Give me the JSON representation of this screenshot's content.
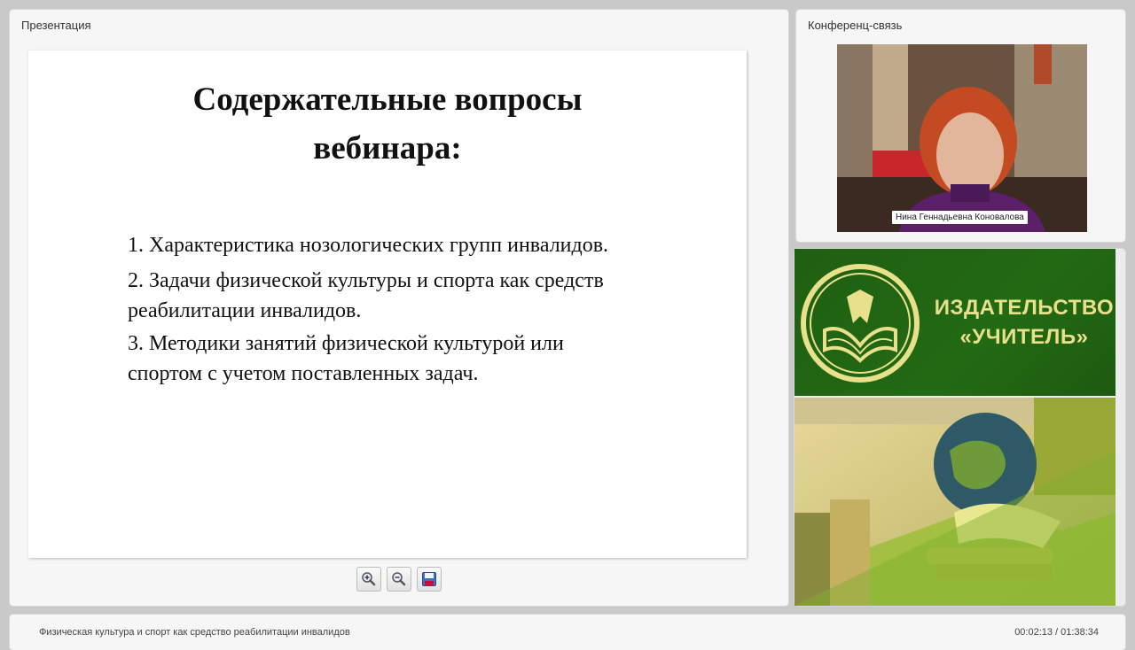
{
  "presentation": {
    "panel_title": "Презентация",
    "slide": {
      "title_line1": "Содержательные вопросы",
      "title_line2": "вебинара:",
      "items": [
        {
          "line1": "1. Характеристика нозологических групп инвалидов.",
          "line2": ""
        },
        {
          "line1": "2. Задачи физической культуры и спорта как средств",
          "line2": "реабилитации инвалидов."
        },
        {
          "line1": "3. Методики занятий физической культурой или",
          "line2": "спортом с учетом поставленных задач."
        }
      ]
    },
    "toolbar": {
      "zoom_in_icon": "zoom-in-icon",
      "zoom_out_icon": "zoom-out-icon",
      "save_icon": "floppy-disk-icon"
    }
  },
  "conference": {
    "panel_title": "Конференц-связь",
    "speaker_name": "Нина Геннадьевна Коновалова"
  },
  "promo": {
    "line1": "ИЗДАТЕЛЬСТВО",
    "line2": "«УЧИТЕЛЬ»",
    "colors": {
      "green": "#236a14",
      "gold": "#e8e08a"
    }
  },
  "footer": {
    "course_title": "Физическая культура и спорт как средство реабилитации инвалидов",
    "time": "00:02:13 / 01:38:34"
  }
}
